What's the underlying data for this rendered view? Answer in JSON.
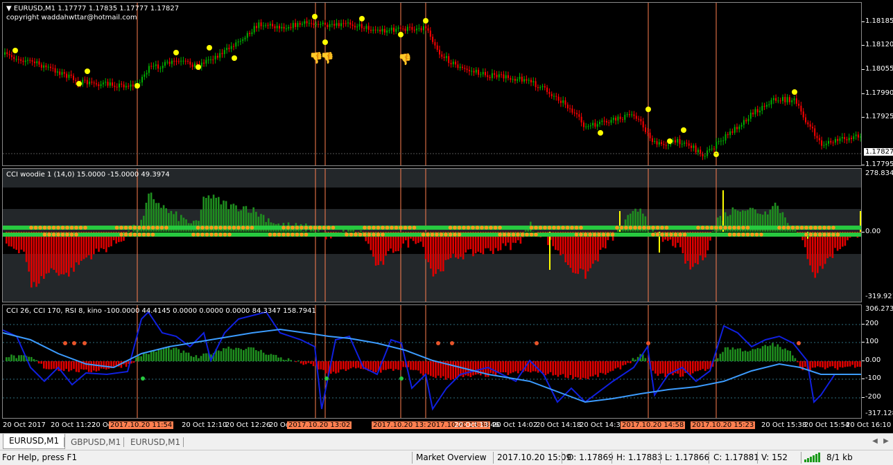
{
  "main_pane": {
    "title": "EURUSD,M1  1.17777 1.17835 1.17777 1.17827",
    "subtitle": "copyright waddahwttar@hotmail.com",
    "collapse_glyph": "▼",
    "price_labels": [
      "1.18185",
      "1.18120",
      "1.18055",
      "1.17990",
      "1.17925",
      "1.17795"
    ],
    "current_price": "1.17827"
  },
  "cci_pane": {
    "title": "CCI woodie 1 (14,0) 15.0000 -15.0000 49.3974",
    "scale_labels": [
      "278.8346",
      "0.00",
      "-319.9212"
    ]
  },
  "rsi_pane": {
    "title": "CCI 26, CCI 170, RSI 8, kino  -100.0000 44.4145 0.0000 0.0000 0.0000 84.3347 158.7941",
    "scale_labels": [
      "306.2732",
      "200",
      "100",
      "0.00",
      "-100",
      "-200",
      "-317.1283"
    ]
  },
  "time_axis": [
    "20 Oct 2017",
    "20 Oct 11:22",
    "20 Oct 11:38",
    "2017.10.20 11:54",
    "20 Oct 12:10",
    "20 Oct 12:26",
    "20 Oct 12:42",
    "2017.10.20 13:02",
    "2017.10.20 13:29",
    "2017.10.20 13:38",
    "20 Oct 13:46",
    "20 Oct 14:02",
    "20 Oct 14:18",
    "20 Oct 14:34",
    "2017.10.20 14:58",
    "2017.10.20 15:23",
    "20 Oct 15:38",
    "20 Oct 15:54",
    "20 Oct 16:10"
  ],
  "tabs": [
    "EURUSD,M1",
    "GBPUSD,M1",
    "EURUSD,M1"
  ],
  "status_bar": {
    "help": "For Help, press F1",
    "profile": "Market Overview",
    "datetime": "2017.10.20 15:09",
    "open": "O: 1.17869",
    "high": "H: 1.17883",
    "low": "L: 1.17866",
    "close": "C: 1.17881",
    "volume": "V: 152",
    "traffic": "8/1 kb"
  },
  "colors": {
    "bull_candle": "#00b000",
    "bear_candle": "#ff0000",
    "signal_line": "#ff7f50",
    "marker": "#ffff00",
    "cci_green": "#1f8f1f",
    "cci_red": "#e00000",
    "cci_line_dark": "#1020e0",
    "cci_line_light": "#3c9cff"
  },
  "icons": [
    "thumbs-down-icon",
    "collapse-triangle-icon",
    "scroll-left-icon",
    "scroll-right-icon",
    "connection-bars-icon"
  ]
}
